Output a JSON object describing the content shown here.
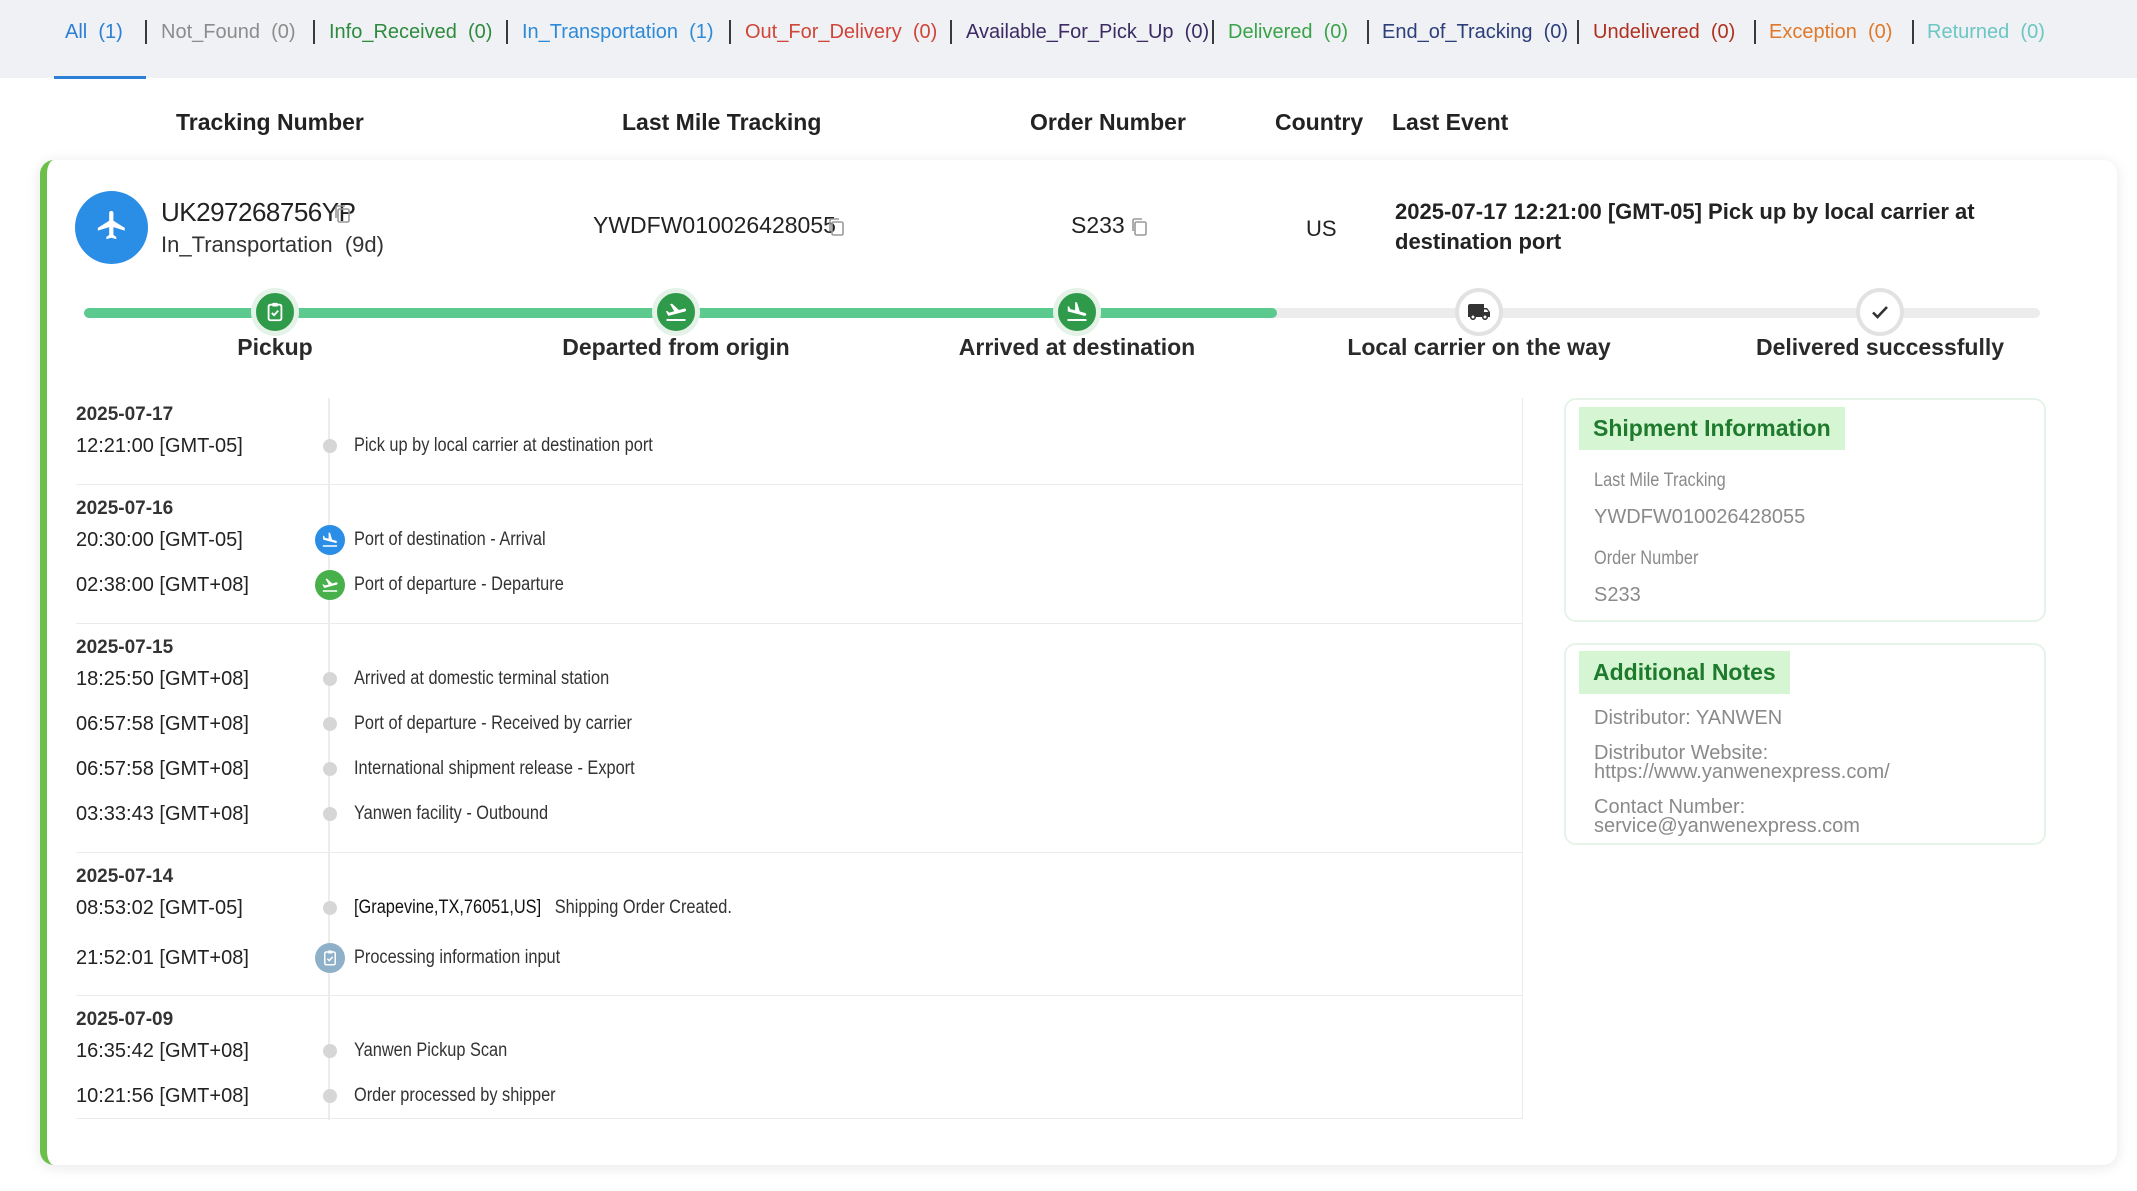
{
  "tabs": [
    {
      "label": "All",
      "count": "(1)",
      "color": "#2b7fd4"
    },
    {
      "label": "Not_Found",
      "count": "(0)",
      "color": "#8c8c8c"
    },
    {
      "label": "Info_Received",
      "count": "(0)",
      "color": "#2e8b3e"
    },
    {
      "label": "In_Transportation",
      "count": "(1)",
      "color": "#2d8ad8"
    },
    {
      "label": "Out_For_Delivery",
      "count": "(0)",
      "color": "#d0453a"
    },
    {
      "label": "Available_For_Pick_Up",
      "count": "(0)",
      "color": "#3b2a63"
    },
    {
      "label": "Delivered",
      "count": "(0)",
      "color": "#3aa34a"
    },
    {
      "label": "End_of_Tracking",
      "count": "(0)",
      "color": "#2c3f7a"
    },
    {
      "label": "Undelivered",
      "count": "(0)",
      "color": "#b0301f"
    },
    {
      "label": "Exception",
      "count": "(0)",
      "color": "#e0782a"
    },
    {
      "label": "Returned",
      "count": "(0)",
      "color": "#6cc6c4"
    }
  ],
  "columns": {
    "tracking_number": "Tracking Number",
    "last_mile": "Last Mile Tracking",
    "order_number": "Order Number",
    "country": "Country",
    "last_event": "Last Event"
  },
  "shipment": {
    "tracking_number": "UK297268756YP",
    "status": "In_Transportation",
    "duration": "(9d)",
    "last_mile": "YWDFW010026428055",
    "order_number": "S233",
    "country": "US",
    "last_event_line1": "2025-07-17 12:21:00 [GMT-05] Pick up by local carrier at",
    "last_event_line2": "destination port",
    "progress_fraction": 0.61
  },
  "steps": [
    {
      "label": "Pickup",
      "done": true,
      "icon": "clipboard-check-icon"
    },
    {
      "label": "Departed from origin",
      "done": true,
      "icon": "plane-departure-icon"
    },
    {
      "label": "Arrived at destination",
      "done": true,
      "icon": "plane-arrival-icon"
    },
    {
      "label": "Local carrier on the way",
      "done": false,
      "icon": "truck-icon"
    },
    {
      "label": "Delivered successfully",
      "done": false,
      "icon": "checkmark-icon"
    }
  ],
  "timeline": [
    {
      "date": "2025-07-17",
      "events": [
        {
          "time": "12:21:00 [GMT-05]",
          "desc": "Pick up by local carrier at destination port",
          "icon": "dot"
        }
      ]
    },
    {
      "date": "2025-07-16",
      "events": [
        {
          "time": "20:30:00 [GMT-05]",
          "desc": "Port of destination - Arrival",
          "icon": "plane-arrival-icon"
        },
        {
          "time": "02:38:00 [GMT+08]",
          "desc": "Port of departure - Departure",
          "icon": "plane-departure-icon"
        }
      ]
    },
    {
      "date": "2025-07-15",
      "events": [
        {
          "time": "18:25:50 [GMT+08]",
          "desc": "Arrived at domestic terminal station",
          "icon": "dot"
        },
        {
          "time": "06:57:58 [GMT+08]",
          "desc": "Port of departure - Received by carrier",
          "icon": "dot"
        },
        {
          "time": "06:57:58 [GMT+08]",
          "desc": "International shipment release - Export",
          "icon": "dot"
        },
        {
          "time": "03:33:43 [GMT+08]",
          "desc": "Yanwen facility - Outbound",
          "icon": "dot"
        }
      ]
    },
    {
      "date": "2025-07-14",
      "events": [
        {
          "time": "08:53:02 [GMT-05]",
          "location": "[Grapevine,TX,76051,US]",
          "desc": "Shipping Order Created.",
          "icon": "dot"
        },
        {
          "time": "21:52:01 [GMT+08]",
          "desc": "Processing information input",
          "icon": "clipboard-check-icon"
        }
      ]
    },
    {
      "date": "2025-07-09",
      "events": [
        {
          "time": "16:35:42 [GMT+08]",
          "desc": "Yanwen Pickup Scan",
          "icon": "dot"
        },
        {
          "time": "10:21:56 [GMT+08]",
          "desc": "Order processed by shipper",
          "icon": "dot"
        }
      ]
    }
  ],
  "shipment_info": {
    "title": "Shipment Information",
    "last_mile_label": "Last Mile Tracking",
    "last_mile_value": "YWDFW010026428055",
    "order_label": "Order Number",
    "order_value": "S233"
  },
  "notes": {
    "title": "Additional Notes",
    "distributor": "Distributor: YANWEN",
    "website_label": "Distributor Website:",
    "website_value": "https://www.yanwenexpress.com/",
    "contact_label": "Contact Number:",
    "contact_value": "service@yanwenexpress.com"
  },
  "colors": {
    "accent_green": "#2f9a4a",
    "progress_green": "#5cc98f",
    "plane_blue": "#2b8ee6",
    "card_border": "#6cc04a"
  }
}
